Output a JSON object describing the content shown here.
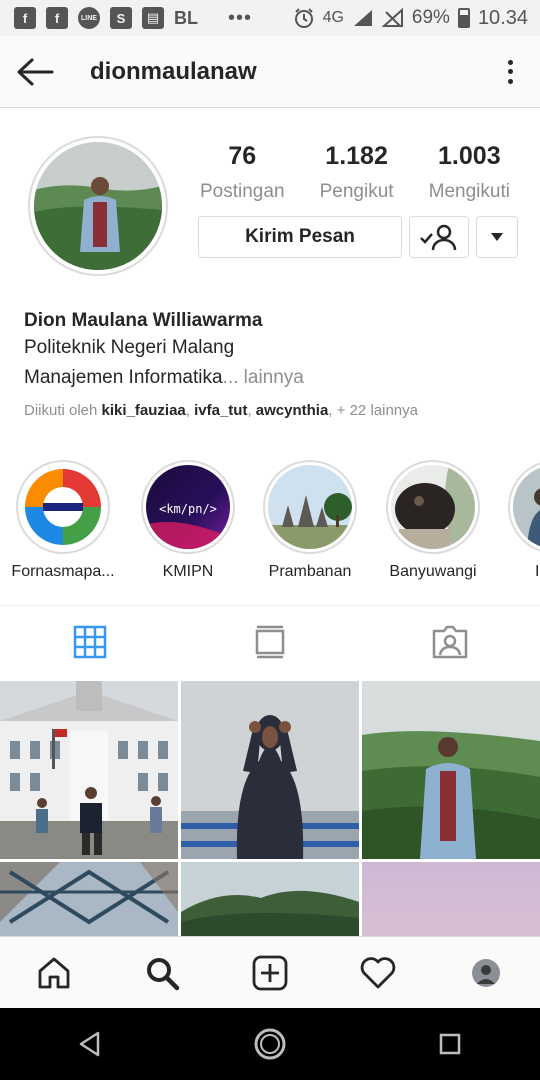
{
  "status_bar": {
    "left_icons": [
      "facebook-icon",
      "facebook-icon",
      "line-icon",
      "shopee-icon",
      "store-icon"
    ],
    "carrier_label": "BL",
    "more_indicator": "•••",
    "network": "4G",
    "battery": "69%",
    "time": "10.34"
  },
  "header": {
    "username": "dionmaulanaw",
    "back_icon": "arrow-left-icon",
    "menu_icon": "vertical-dots-icon"
  },
  "profile": {
    "stats": [
      {
        "value": "76",
        "label": "Postingan"
      },
      {
        "value": "1.182",
        "label": "Pengikut"
      },
      {
        "value": "1.003",
        "label": "Mengikuti"
      }
    ],
    "message_button": "Kirim Pesan",
    "full_name": "Dion Maulana Williawarma",
    "bio_line1": "Politeknik Negeri Malang",
    "bio_line2": "Manajemen Informatika",
    "bio_more": "... lainnya",
    "followed_prefix": "Diikuti oleh ",
    "followed_users": [
      "kiki_fauziaa",
      "ivfa_tut",
      "awcynthia"
    ],
    "followed_sep": ", ",
    "followed_suffix": ", + 22 lainnya"
  },
  "highlights": [
    {
      "label": "Fornasmapa..."
    },
    {
      "label": "KMIPN",
      "badge_text": "<km/pn/>"
    },
    {
      "label": "Prambanan"
    },
    {
      "label": "Banyuwangi"
    },
    {
      "label": "Ied M"
    }
  ],
  "tabs": [
    {
      "name": "grid-icon",
      "active": true
    },
    {
      "name": "feed-icon",
      "active": false
    },
    {
      "name": "tagged-icon",
      "active": false
    }
  ],
  "bottom_nav": [
    "home-icon",
    "search-icon",
    "add-post-icon",
    "heart-icon",
    "profile-avatar"
  ],
  "system_nav": [
    "back-triangle-icon",
    "home-circle-icon",
    "recents-square-icon"
  ],
  "colors": {
    "text": "#262626",
    "muted": "#8e8e8e",
    "border": "#dbdbdb",
    "active_tab": "#3897f0"
  }
}
